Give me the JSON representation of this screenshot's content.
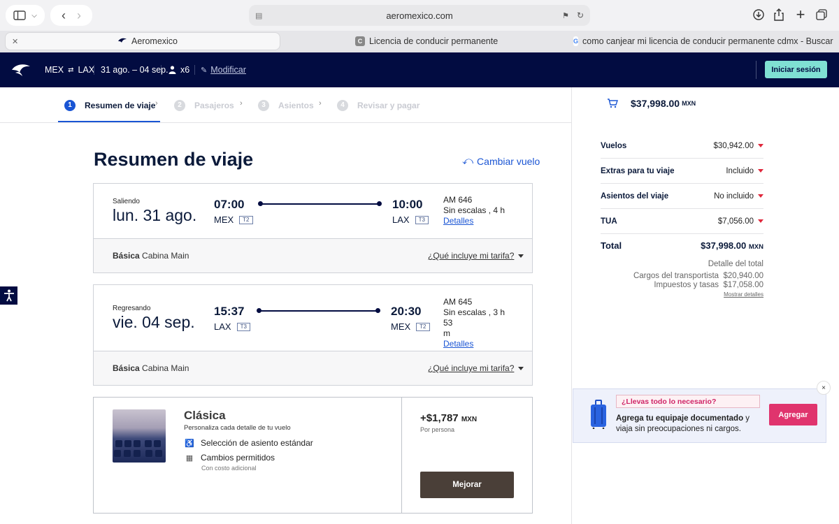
{
  "browser": {
    "url": "aeromexico.com",
    "tabs": [
      {
        "label": "Aeromexico",
        "favicon": "aeromexico-logo"
      },
      {
        "label": "Licencia de conducir permanente",
        "favicon": "C"
      },
      {
        "label": "como canjear mi licencia de conducir permanente cdmx - Buscar c...",
        "favicon": "G"
      }
    ]
  },
  "header": {
    "route_from": "MEX",
    "route_to": "LAX",
    "dates": "31 ago. – 04 sep.",
    "passengers": "x6",
    "modify_label": "Modificar",
    "login_label": "Iniciar sesión"
  },
  "steps": [
    {
      "num": "1",
      "label": "Resumen de viaje",
      "active": true
    },
    {
      "num": "2",
      "label": "Pasajeros",
      "active": false
    },
    {
      "num": "3",
      "label": "Asientos",
      "active": false
    },
    {
      "num": "4",
      "label": "Revisar y pagar",
      "active": false
    }
  ],
  "main": {
    "title": "Resumen de viaje",
    "change_flight": "Cambiar vuelo",
    "flights": [
      {
        "direction": "Saliendo",
        "date": "lun. 31 ago.",
        "dep_time": "07:00",
        "dep_airport": "MEX",
        "dep_terminal": "T2",
        "arr_time": "10:00",
        "arr_airport": "LAX",
        "arr_terminal": "T3",
        "flight_no": "AM 646",
        "stops": "Sin escalas , 4 h",
        "details": "Detalles",
        "fare_type": "Básica",
        "cabin": "Cabina Main",
        "fare_question": "¿Qué incluye mi tarifa?"
      },
      {
        "direction": "Regresando",
        "date": "vie. 04 sep.",
        "dep_time": "15:37",
        "dep_airport": "LAX",
        "dep_terminal": "T3",
        "arr_time": "20:30",
        "arr_airport": "MEX",
        "arr_terminal": "T2",
        "flight_no": "AM 645",
        "stops": "Sin escalas , 3 h 53",
        "stops_cont": "m",
        "details": "Detalles",
        "fare_type": "Básica",
        "cabin": "Cabina Main",
        "fare_question": "¿Qué incluye mi tarifa?"
      }
    ],
    "upsell": {
      "title": "Clásica",
      "subtitle": "Personaliza cada detalle de tu vuelo",
      "feature1": "Selección de asiento estándar",
      "feature2": "Cambios permitidos",
      "feature2_note": "Con costo adicional",
      "price": "+$1,787",
      "currency": "MXN",
      "per_person": "Por persona",
      "button": "Mejorar"
    }
  },
  "summary": {
    "cart_total": "$37,998.00",
    "cart_currency": "MXN",
    "rows": [
      {
        "label": "Vuelos",
        "value": "$30,942.00"
      },
      {
        "label": "Extras para tu viaje",
        "value": "Incluido"
      },
      {
        "label": "Asientos del viaje",
        "value": "No incluido"
      },
      {
        "label": "TUA",
        "value": "$7,056.00"
      }
    ],
    "total_label": "Total",
    "total_value": "$37,998.00",
    "total_currency": "MXN",
    "breakdown_title": "Detalle del total",
    "carrier_charges": "Cargos del transportista",
    "carrier_value": "$20,940.00",
    "taxes": "Impuestos y tasas",
    "taxes_value": "$17,058.00",
    "show_details": "Mostrar detalles"
  },
  "promo": {
    "tag": "¿Llevas todo lo necesario?",
    "text_bold": "Agrega tu equipaje documentado",
    "text_rest": " y viaja sin preocupaciones ni cargos.",
    "button": "Agregar",
    "close": "×"
  },
  "colors": {
    "header_bg": "#020c41",
    "accent_blue": "#1a55d4",
    "login_btn": "#7fe0d3",
    "promo_pink": "#e0346d",
    "caret_red": "#e0283c"
  }
}
